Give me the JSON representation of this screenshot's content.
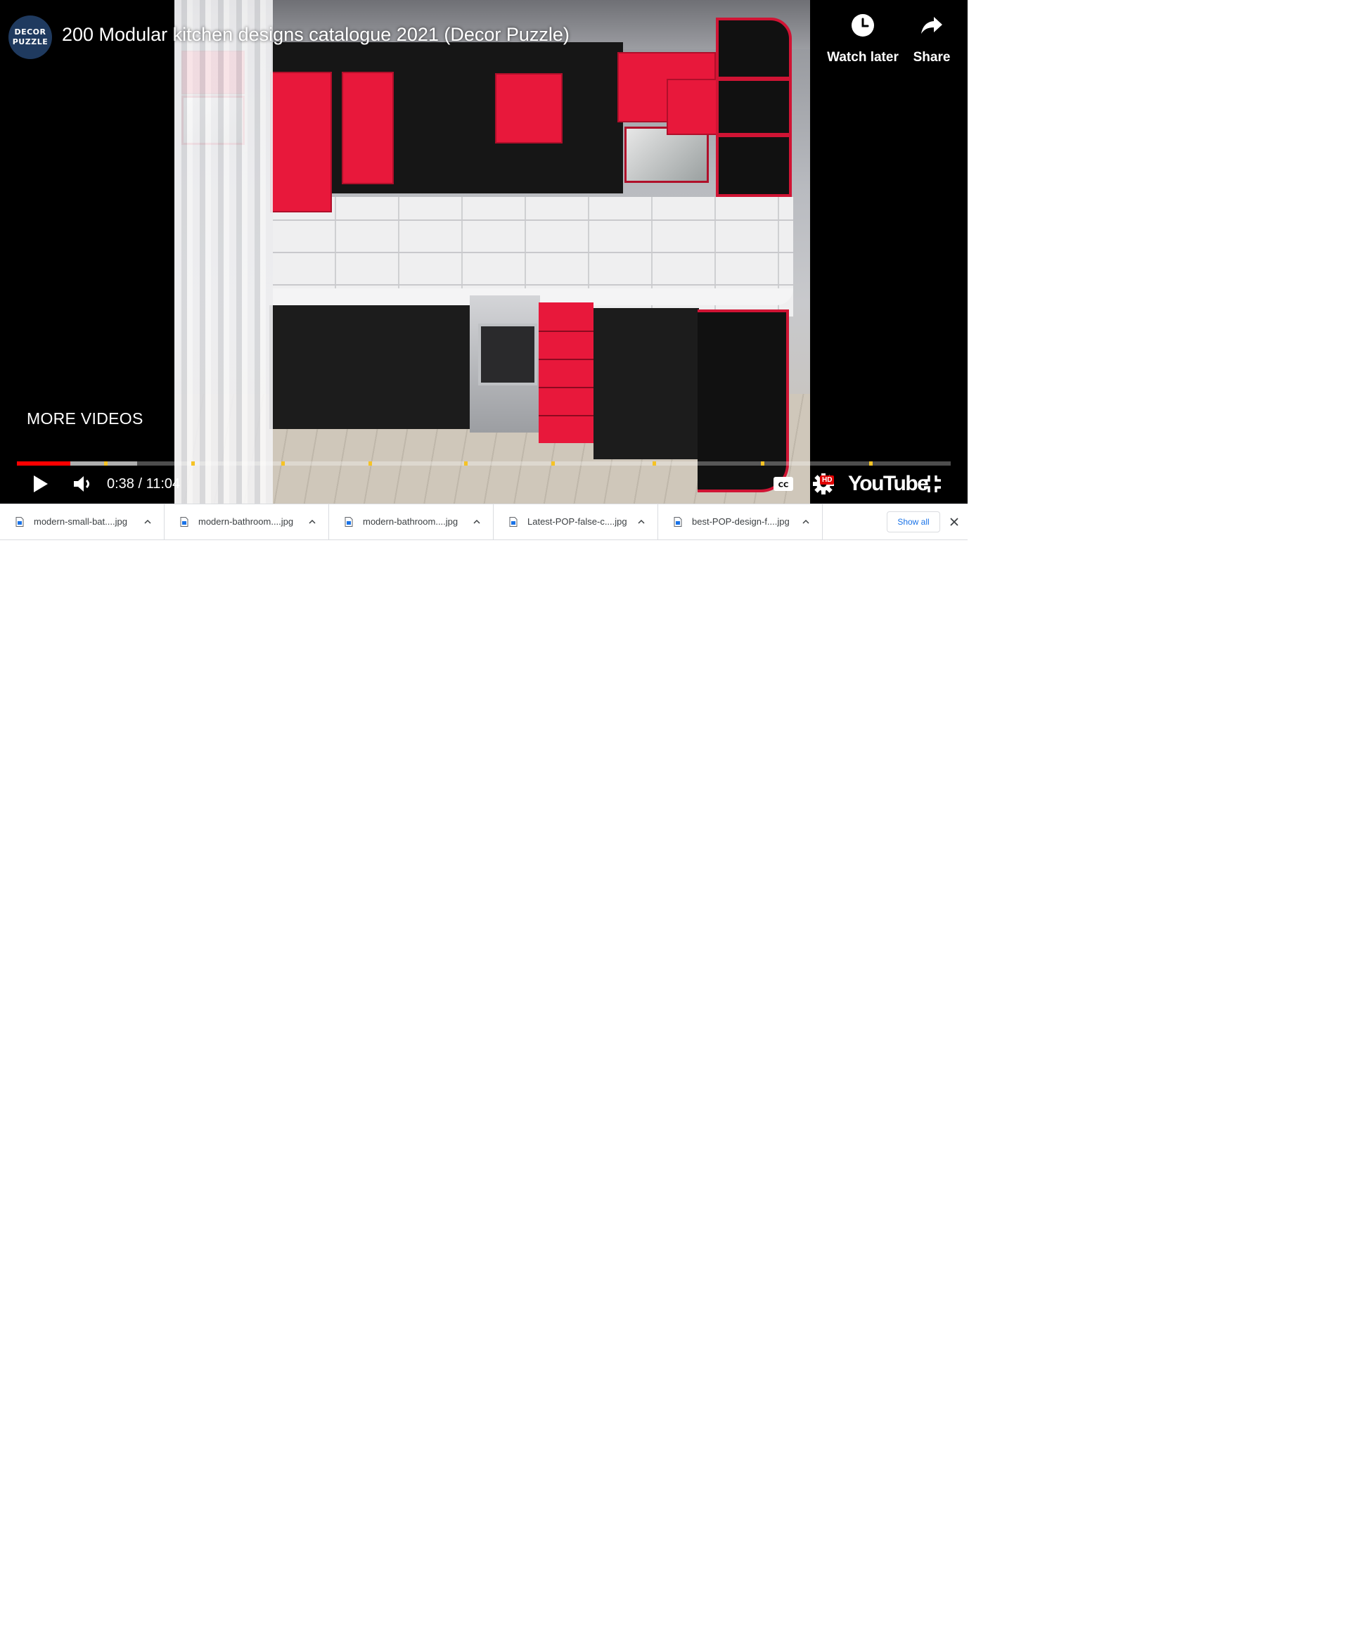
{
  "player": {
    "channel_avatar_line1": "DECOR",
    "channel_avatar_line2": "PUZZLE",
    "title": "200 Modular kitchen designs catalogue 2021 (Decor Puzzle)",
    "watch_later_label": "Watch later",
    "share_label": "Share",
    "more_videos_label": "MORE VIDEOS",
    "time_display": "0:38 / 11:04",
    "progress_fraction": 0.057,
    "buffered_fraction": 0.129,
    "hd_badge": "HD",
    "youtube_logo_text": "YouTube",
    "colors": {
      "progress_played": "#ff0000",
      "chapter_marker": "#f6c325",
      "hd_badge": "#e00000"
    }
  },
  "downloads": {
    "items": [
      {
        "name": "modern-small-bat....jpg"
      },
      {
        "name": "modern-bathroom....jpg"
      },
      {
        "name": "modern-bathroom....jpg"
      },
      {
        "name": "Latest-POP-false-c....jpg"
      },
      {
        "name": "best-POP-design-f....jpg"
      }
    ],
    "show_all_label": "Show all"
  },
  "icons": [
    "watch-later-icon",
    "share-icon",
    "play-icon",
    "volume-icon",
    "cc-icon",
    "settings-icon",
    "exit-fullscreen-icon",
    "file-icon",
    "chevron-up-icon",
    "close-icon"
  ]
}
